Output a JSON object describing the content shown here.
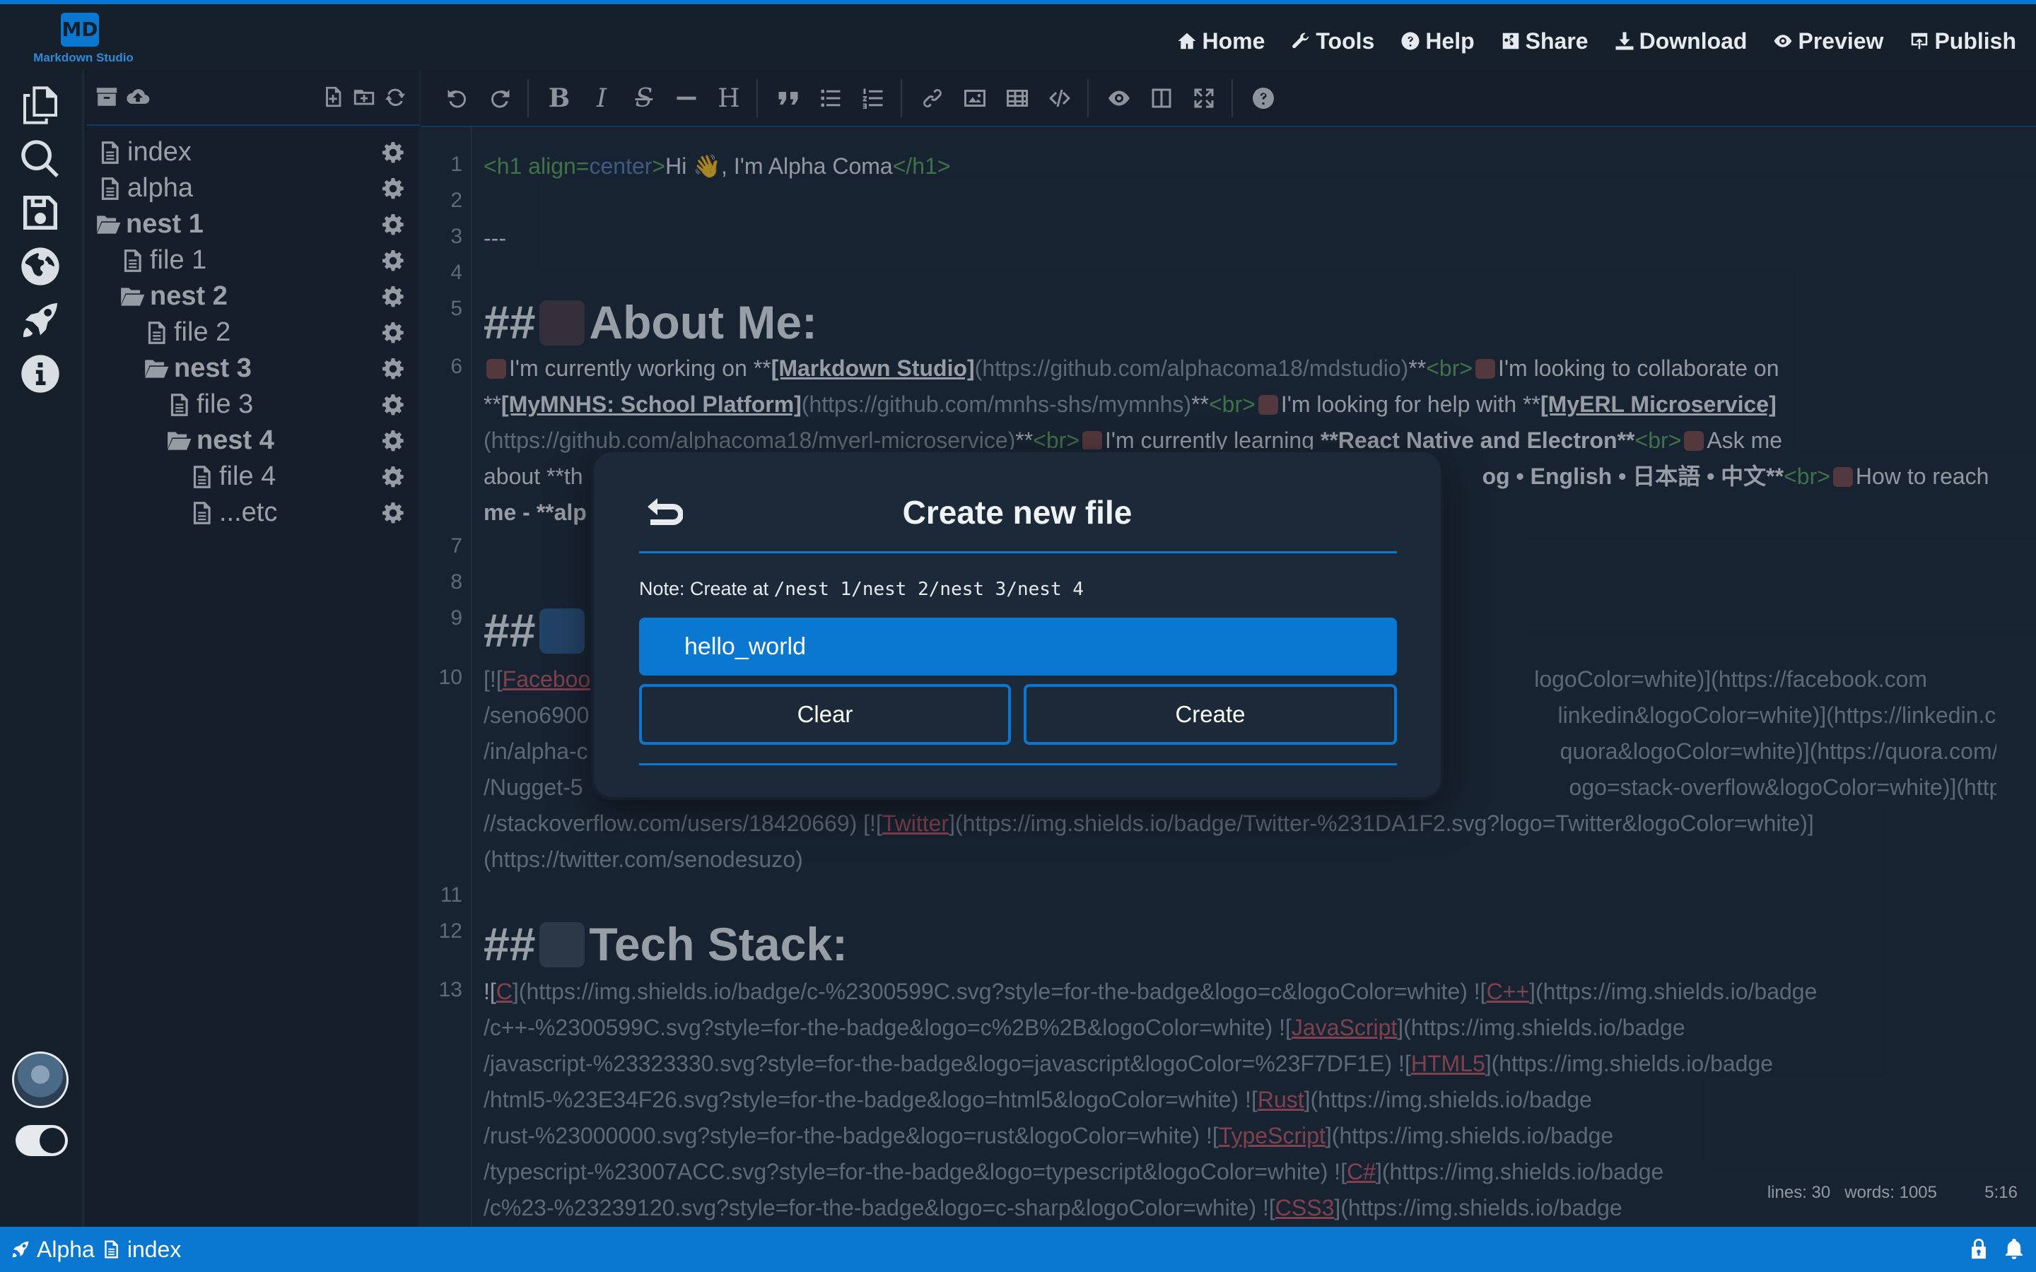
{
  "app": {
    "logo_mark": "MD",
    "logo_text": "Markdown Studio"
  },
  "topnav": {
    "items": [
      {
        "label": "Home",
        "icon": "home-icon"
      },
      {
        "label": "Tools",
        "icon": "wrench-icon"
      },
      {
        "label": "Help",
        "icon": "help-circle-icon"
      },
      {
        "label": "Share",
        "icon": "share-icon"
      },
      {
        "label": "Download",
        "icon": "download-icon"
      },
      {
        "label": "Preview",
        "icon": "eye-icon"
      },
      {
        "label": "Publish",
        "icon": "publish-icon"
      }
    ]
  },
  "sidebar": {
    "icons": [
      "files-icon",
      "search-icon",
      "save-icon",
      "globe-icon",
      "rocket-icon",
      "info-icon"
    ],
    "bottom": [
      "avatar",
      "theme-toggle",
      "settings-gears-icon"
    ]
  },
  "filetree": {
    "toolbar_icons": [
      "archive-icon",
      "cloud-upload-icon",
      "new-file-icon",
      "new-folder-icon",
      "refresh-icon"
    ],
    "items": [
      {
        "label": "index",
        "type": "file",
        "depth": 0
      },
      {
        "label": "alpha",
        "type": "file",
        "depth": 0
      },
      {
        "label": "nest 1",
        "type": "folder",
        "depth": 0
      },
      {
        "label": "file 1",
        "type": "file",
        "depth": 1
      },
      {
        "label": "nest 2",
        "type": "folder",
        "depth": 1
      },
      {
        "label": "file 2",
        "type": "file",
        "depth": 2
      },
      {
        "label": "nest 3",
        "type": "folder",
        "depth": 2
      },
      {
        "label": "file 3",
        "type": "file",
        "depth": 3
      },
      {
        "label": "nest 4",
        "type": "folder",
        "depth": 3
      },
      {
        "label": "file 4",
        "type": "file",
        "depth": 4
      },
      {
        "label": "...etc",
        "type": "file",
        "depth": 4
      }
    ]
  },
  "toolbar": {
    "buttons": [
      "undo",
      "redo",
      "bold",
      "italic",
      "strikethrough",
      "horizontal-rule",
      "heading",
      "quote",
      "unordered-list",
      "ordered-list",
      "link",
      "image",
      "table",
      "code",
      "preview",
      "side-by-side",
      "fullscreen",
      "guide"
    ],
    "letters": {
      "bold": "B",
      "italic": "I",
      "strike": "S",
      "heading": "H"
    }
  },
  "editor": {
    "line_numbers": [
      "1",
      "2",
      "3",
      "4",
      "5",
      "6",
      "7",
      "8",
      "9",
      "10",
      "11",
      "12",
      "13"
    ],
    "l1": {
      "open": "<h1 align=",
      "attr": "center",
      "close_open": ">",
      "text": "Hi 👋, I'm Alpha Coma",
      "close": "</h1>"
    },
    "l3": "---",
    "l5": {
      "hash": "##",
      "text": "About Me:"
    },
    "l6a": {
      "t1": "I'm currently working on **",
      "link": "[Markdown Studio]",
      "url": "(https://github.com/alphacoma18/mdstudio)",
      "t2": "**",
      "br": "<br>",
      "t3": "I'm looking to collaborate on"
    },
    "l6b": {
      "t1": "**",
      "link": "[MyMNHS: School Platform]",
      "url": "(https://github.com/mnhs-shs/mymnhs)",
      "t2": "**",
      "br": "<br>",
      "t3": "I'm looking for help with **",
      "link2": "[MyERL Microservice]"
    },
    "l6c": {
      "url": "(https://github.com/alphacoma18/myerl-microservice)",
      "t1": "**",
      "br": "<br>",
      "t2": "I'm currently learning ",
      "bold": "**React Native and Electron**",
      "br2": "<br>",
      "t3": "Ask me"
    },
    "l6d": {
      "t1": "about **th",
      "t2": "og • English • 日本語 • 中文**",
      "br": "<br>",
      "t3": "How to reach"
    },
    "l6e": {
      "t1": "me - **alp"
    },
    "l9": {
      "hash": "##"
    },
    "l10a": {
      "lead": "[![",
      "link": "Faceboo",
      "tail": "logoColor=white)](https://facebook.com"
    },
    "l10b": {
      "lead": "/seno6900",
      "tail": "linkedin&logoColor=white)](https://linkedin.com"
    },
    "l10c": {
      "lead": "/in/alpha-c",
      "tail": "quora&logoColor=white)](https://quora.com/profile"
    },
    "l10d": {
      "lead": "/Nugget-5",
      "tail": "ogo=stack-overflow&logoColor=white)](https:"
    },
    "l10e": {
      "t1": "//stackoverflow.com/users/18420669) ",
      "t2": "[![",
      "link": "Twitter",
      "t3": "](https://img.shields.io/badge/Twitter-%231DA1F2.svg?logo=Twitter&logoColor=white)]"
    },
    "l10f": "(https://twitter.com/senodesuzo)",
    "l12": {
      "hash": "##",
      "text": "Tech Stack:"
    },
    "l13a": {
      "t1": "![",
      "link1": "C",
      "t2": "](https://img.shields.io/badge/c-%2300599C.svg?style=for-the-badge&logo=c&logoColor=white) ![",
      "link2": "C++",
      "t3": "](https://img.shields.io/badge"
    },
    "l13b": {
      "t1": "/c++-%2300599C.svg?style=for-the-badge&logo=c%2B%2B&logoColor=white) ![",
      "link": "JavaScript",
      "t2": "](https://img.shields.io/badge"
    },
    "l13c": {
      "t1": "/javascript-%23323330.svg?style=for-the-badge&logo=javascript&logoColor=%23F7DF1E) ![",
      "link": "HTML5",
      "t2": "](https://img.shields.io/badge"
    },
    "l13d": {
      "t1": "/html5-%23E34F26.svg?style=for-the-badge&logo=html5&logoColor=white) ![",
      "link": "Rust",
      "t2": "](https://img.shields.io/badge"
    },
    "l13e": {
      "t1": "/rust-%23000000.svg?style=for-the-badge&logo=rust&logoColor=white) ![",
      "link": "TypeScript",
      "t2": "](https://img.shields.io/badge"
    },
    "l13f": {
      "t1": "/typescript-%23007ACC.svg?style=for-the-badge&logo=typescript&logoColor=white) ![",
      "link": "C#",
      "t2": "](https://img.shields.io/badge"
    },
    "l13g": {
      "t1": "/c%23-%23239120.svg?style=for-the-badge&logo=c-sharp&logoColor=white) ![",
      "link": "CSS3",
      "t2": "](https://img.shields.io/badge"
    }
  },
  "status": {
    "lines": "lines: 30",
    "words": "words: 1005",
    "cursor": "5:16"
  },
  "bottombar": {
    "user": "Alpha",
    "file": "index",
    "right_icons": [
      "lock-icon",
      "bell-icon"
    ]
  },
  "modal": {
    "title": "Create new file",
    "note_prefix": "Note: Create at ",
    "note_path": "/nest 1/nest 2/nest 3/nest 4",
    "input_value": "hello_world",
    "clear_label": "Clear",
    "create_label": "Create"
  },
  "colors": {
    "accent": "#0a78d0",
    "panel": "#16202b",
    "editor_bg": "#1b2836",
    "link": "#c25866",
    "tag": "#58a75c"
  }
}
